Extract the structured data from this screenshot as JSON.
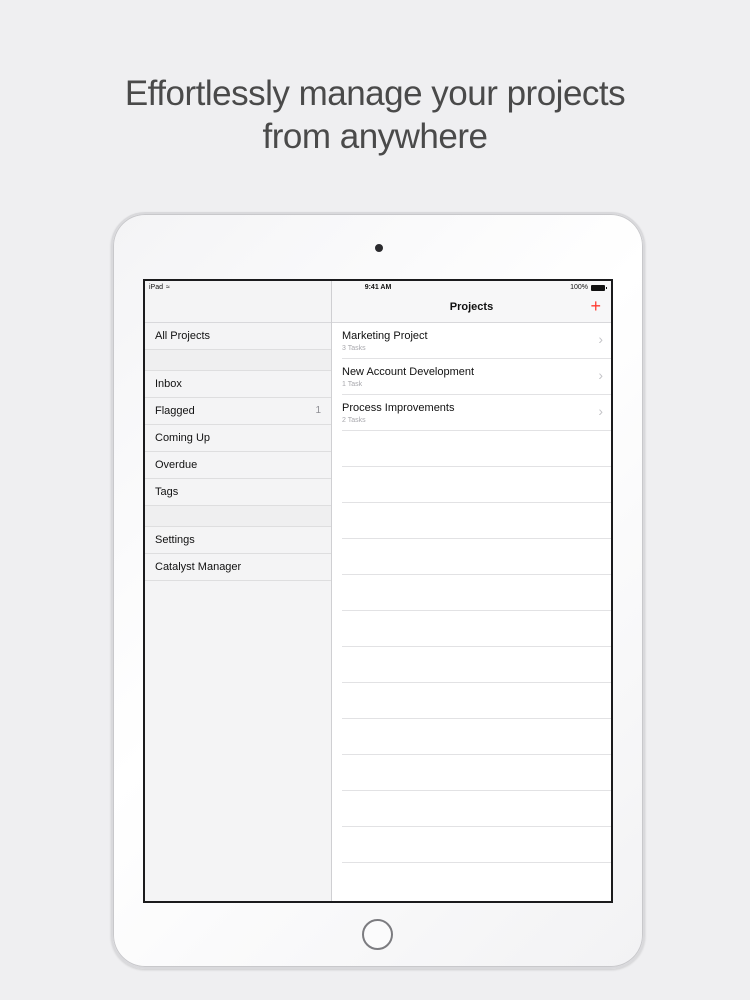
{
  "headline": {
    "line1": "Effortlessly manage your projects",
    "line2": "from anywhere"
  },
  "status_bar": {
    "device": "iPad",
    "time": "9:41 AM",
    "battery": "100%"
  },
  "sidebar": {
    "items": [
      {
        "label": "All Projects"
      },
      {
        "label": "Inbox"
      },
      {
        "label": "Flagged",
        "count": "1"
      },
      {
        "label": "Coming Up"
      },
      {
        "label": "Overdue"
      },
      {
        "label": "Tags"
      },
      {
        "label": "Settings"
      },
      {
        "label": "Catalyst Manager"
      }
    ]
  },
  "main": {
    "title": "Projects",
    "add_icon": "plus-icon",
    "projects": [
      {
        "name": "Marketing Project",
        "subtitle": "3 Tasks"
      },
      {
        "name": "New Account Development",
        "subtitle": "1 Task"
      },
      {
        "name": "Process Improvements",
        "subtitle": "2 Tasks"
      }
    ]
  },
  "colors": {
    "accent": "#ff3b30",
    "background": "#efeff1"
  }
}
